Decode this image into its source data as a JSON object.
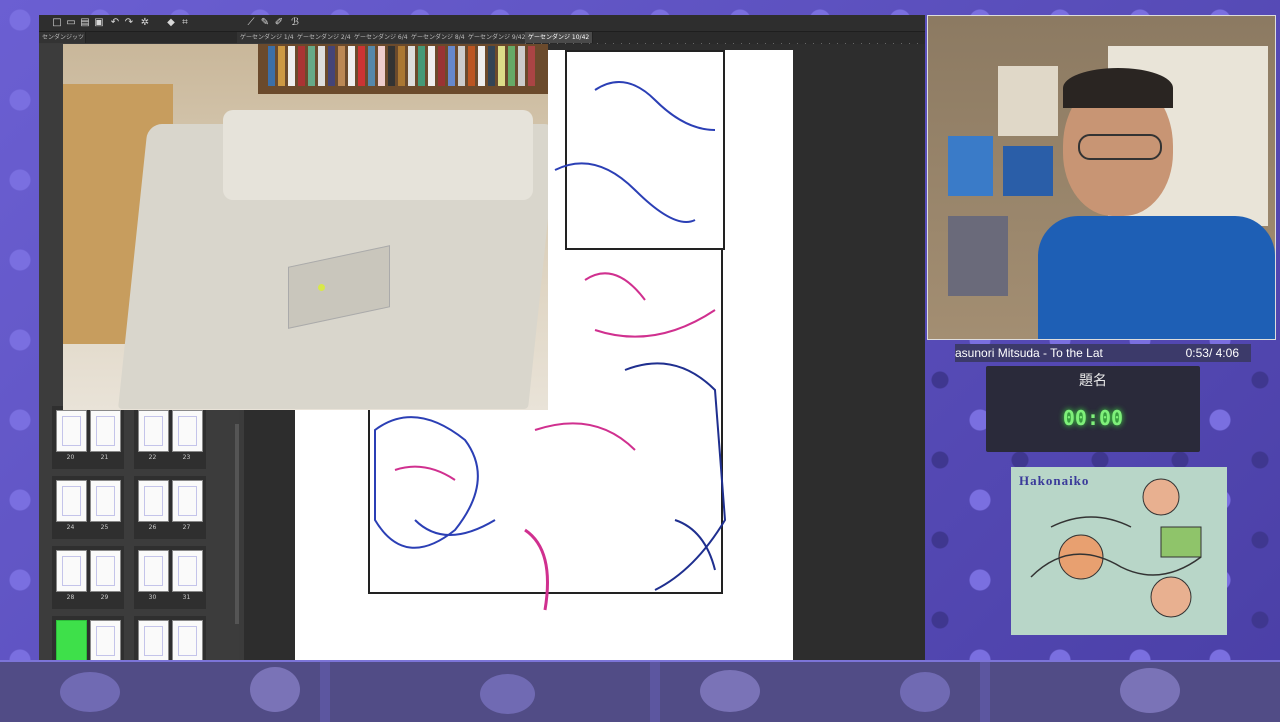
{
  "app": {
    "tabs": [
      {
        "label": "ゲーセンダンジ 1/42",
        "active": false
      },
      {
        "label": "ゲーセンダンジ 2/42",
        "active": false
      },
      {
        "label": "ゲーセンダンジ 6/42",
        "active": false
      },
      {
        "label": "ゲーセンダンジ 8/42",
        "active": false
      },
      {
        "label": "ゲーセンダンジ 9/42",
        "active": false
      },
      {
        "label": "ゲーセンダンジ 10/42",
        "active": true
      }
    ],
    "page_panel_tab": "センダンジッツ",
    "page_numbers": [
      "20",
      "21",
      "22",
      "23",
      "24",
      "25",
      "26",
      "27",
      "28",
      "29",
      "30",
      "31"
    ]
  },
  "overlay": {
    "music_title": "asunori Mitsuda - To the Lat",
    "music_time": "0:53/ 4:06",
    "timer_label": "題名",
    "timer_value": "00:00",
    "artwork_title": "Hakonaiko"
  },
  "colors": {
    "background": "#5a4fb8",
    "timer_digits": "#7ff07a",
    "shirt": "#1e5fb5"
  }
}
